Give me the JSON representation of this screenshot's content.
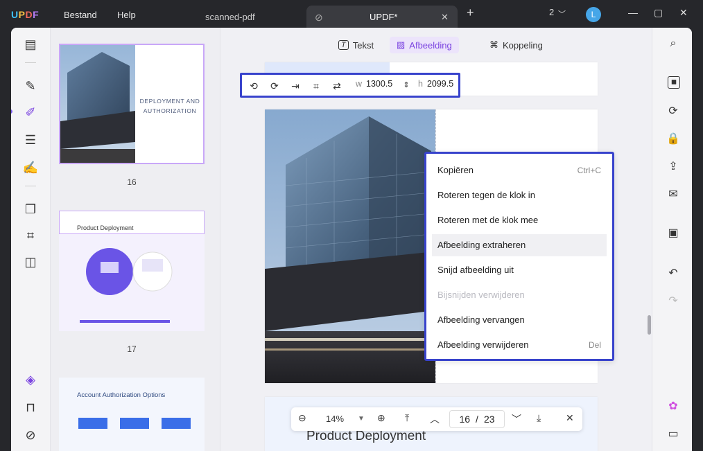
{
  "app": {
    "logo": "UPDF",
    "menu": [
      "Bestand",
      "Help"
    ],
    "tabs": [
      {
        "label": "scanned-pdf",
        "active": false
      },
      {
        "label": "UPDF*",
        "active": true
      }
    ],
    "window_count": "2",
    "avatar_letter": "L"
  },
  "top_tools": {
    "text": "Tekst",
    "image": "Afbeelding",
    "link": "Koppeling"
  },
  "image_toolbar": {
    "w_label": "w",
    "w_value": "1300.5",
    "h_label": "h",
    "h_value": "2099.5"
  },
  "thumbnails": [
    {
      "page": "16",
      "title_line1": "DEPLOYMENT AND",
      "title_line2": "AUTHORIZATION",
      "selected": true
    },
    {
      "page": "17",
      "title": "Product Deployment",
      "selected": false
    },
    {
      "title": "Account Authorization Options"
    }
  ],
  "context_menu": [
    {
      "label": "Kopiëren",
      "shortcut": "Ctrl+C",
      "state": "normal"
    },
    {
      "label": "Roteren tegen de klok in",
      "shortcut": "",
      "state": "normal"
    },
    {
      "label": "Roteren met de klok mee",
      "shortcut": "",
      "state": "normal"
    },
    {
      "label": "Afbeelding extraheren",
      "shortcut": "",
      "state": "highlighted"
    },
    {
      "label": "Snijd afbeelding uit",
      "shortcut": "",
      "state": "normal"
    },
    {
      "label": "Bijsnijden verwijderen",
      "shortcut": "",
      "state": "disabled"
    },
    {
      "label": "Afbeelding vervangen",
      "shortcut": "",
      "state": "normal"
    },
    {
      "label": "Afbeelding verwijderen",
      "shortcut": "Del",
      "state": "normal"
    }
  ],
  "next_page_heading": "Product Deployment",
  "zoom": {
    "level": "14%",
    "current_page": "16",
    "separator": "/",
    "total_pages": "23"
  },
  "colors": {
    "accent": "#7a43e0",
    "highlight_border": "#3843cc",
    "titlebar": "#26272b"
  }
}
